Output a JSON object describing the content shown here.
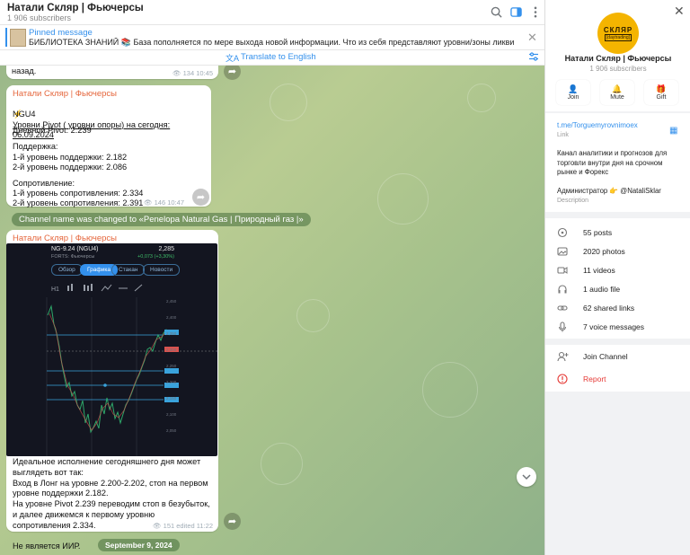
{
  "header": {
    "title": "Натали Скляр | Фьючерсы",
    "subscribers": "1 906 subscribers"
  },
  "pinned": {
    "title": "Pinned message",
    "text": "БИБЛИОТЕКА ЗНАНИЙ 📚 База пополняется по мере выхода новой информации. Что из себя представляют уровни/зоны ликвидности https://t.me/Torguem..."
  },
  "translate": {
    "label": "Translate to English"
  },
  "messages": {
    "partial": {
      "text": "назад.",
      "views": "134",
      "time": "10:45"
    },
    "pivot": {
      "author": "Натали Скляр | Фьючерсы",
      "heading": "Уровни Pivot ( уровни опоры) на сегодня: 06.09.2024",
      "ticker": "NGU4",
      "daily_pivot": "Дневной Pivot: 2.239",
      "support_title": "Поддержка:",
      "support1": " 1-й уровень поддержки: 2.182",
      "support2": " 2-й уровень поддержки: 2.086",
      "resist_title": "Сопротивление:",
      "resist1": " 1-й уровень сопротивления: 2.334",
      "resist2": " 2-й уровень сопротивления: 2.391",
      "views": "146",
      "time": "10:47"
    },
    "service": "Channel name was changed to «Penelopa Natural Gas | Природный газ  |»",
    "photo": {
      "author": "Натали Скляр | Фьючерсы",
      "image": {
        "instrument": "NG-9.24 (NGU4)",
        "price": "2,285",
        "exchange": "FORTS: Фьючерсы",
        "change": "+0,073 (+3,30%)",
        "tabs": [
          "Обзор",
          "Графика",
          "Стакан",
          "Новости"
        ],
        "active_tab": "Графика",
        "price_labels": [
          "2,450",
          "2,400",
          "2,350",
          "2,300",
          "2,250",
          "2,200",
          "2,150",
          "2,100",
          "2,050"
        ]
      },
      "text": "Идеальное исполнение сегодняшнего дня может выглядеть вот так:\nВход в Лонг  на уровне 2.200-2.202, стоп на первом уровне поддержки 2.182.\nНа уровне Pivot 2.239 переводим стоп в безубыток, и далее движемся к первому уровню сопротивления 2.334.\n\nНе является ИИР.",
      "views": "151",
      "edited": "edited 11:22"
    },
    "date_pill": "September 9, 2024"
  },
  "panel": {
    "avatar_line1": "СКЛЯР",
    "avatar_line2": "[daytrading]",
    "name": "Натали Скляр | Фьючерсы",
    "subscribers": "1 906 subscribers",
    "actions": [
      "Join",
      "Mute",
      "Gift"
    ],
    "link": "t.me/Torguemyrovnimoex",
    "link_caption": "Link",
    "description": "Канал аналитики и прогнозов для торговли внутри дня на срочном рынке и Форекс\n\nАдминистратор 👉 @NataliSklar",
    "description_caption": "Description",
    "stats": [
      "55 posts",
      "2020 photos",
      "11 videos",
      "1 audio file",
      "62 shared links",
      "7 voice messages"
    ],
    "join_channel": "Join Channel",
    "report": "Report"
  },
  "colors": {
    "accent": "#3390ec",
    "author": "#e5663c",
    "report": "#e53935"
  }
}
